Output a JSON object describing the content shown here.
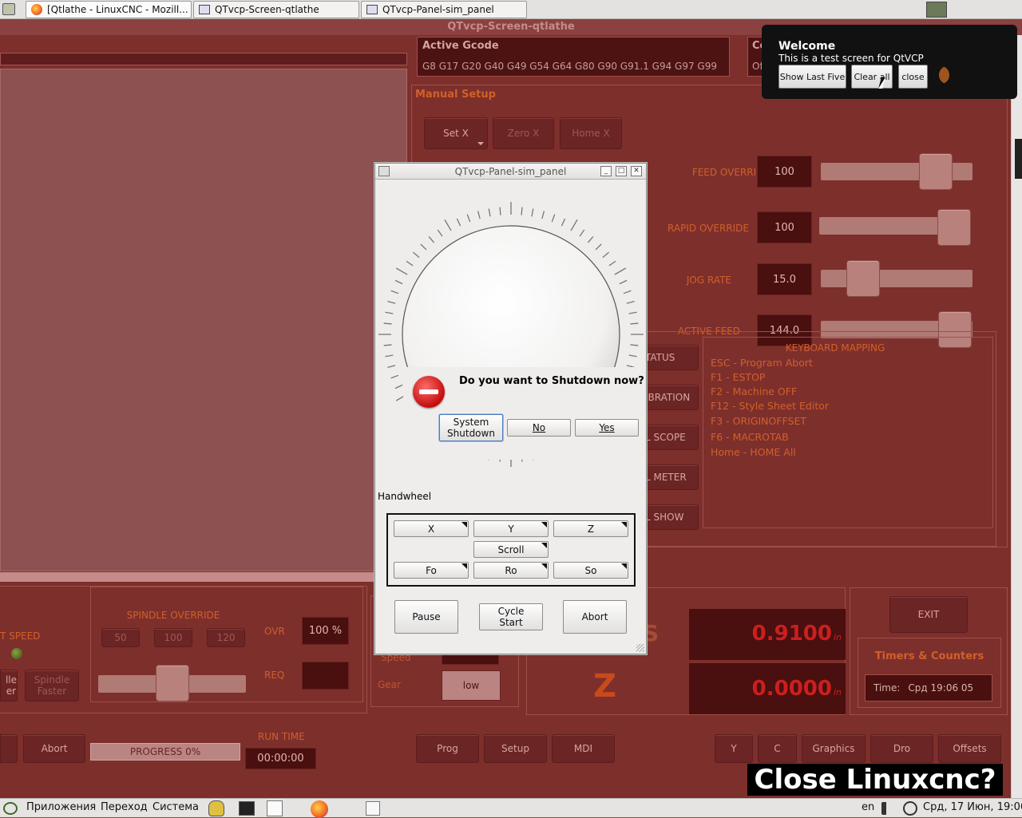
{
  "taskbar_top": {
    "tabs": [
      {
        "label": "[Qtlathe - LinuxCNC - Mozill..."
      },
      {
        "label": "QTvcp-Screen-qtlathe"
      },
      {
        "label": "QTvcp-Panel-sim_panel"
      }
    ]
  },
  "window": {
    "title": "QTvcp-Screen-qtlathe"
  },
  "gcode": {
    "title": "Active Gcode",
    "codes": "G8 G17 G20 G40 G49 G54 G64 G80 G90 G91.1 G94 G97 G99",
    "next_title_fragment": "Co",
    "next_value_fragment": "Of"
  },
  "manual_setup": {
    "title": "Manual Setup",
    "buttons": [
      "Set X",
      "Zero X",
      "Home X"
    ]
  },
  "overrides": [
    {
      "label": "FEED OVERRIDE",
      "value": "100",
      "level": 0.75
    },
    {
      "label": "RAPID OVERRIDE",
      "value": "100",
      "level": 1.0
    },
    {
      "label": "JOG RATE",
      "value": "15.0",
      "level": 0.2
    },
    {
      "label": "ACTIVE FEED",
      "value": "144.0",
      "level": 1.0
    }
  ],
  "side_buttons": [
    "TATUS",
    "IBRATION",
    "L SCOPE",
    "L METER",
    "L SHOW"
  ],
  "keyboard_mapping": {
    "title": "KEYBOARD MAPPING",
    "items": [
      "ESC - Program Abort",
      "F1 - ESTOP",
      "F2 - Machine OFF",
      "F12 - Style Sheet Editor",
      "F3 - ORIGINOFFSET",
      "F6 - MACROTAB",
      "Home - HOME All"
    ]
  },
  "spindle": {
    "title": "SPINDLE OVERRIDE",
    "presets": [
      "50",
      "100",
      "120"
    ],
    "ovr_label": "OVR",
    "ovr_value": "100 %",
    "req_label": "REQ",
    "speed_label_fragment": "T SPEED",
    "slower_fragment": "lle\ner",
    "faster_label": "Spindle\nFaster",
    "level": 0.5
  },
  "gear": {
    "speed_label": "Speed",
    "gear_label": "Gear",
    "gear_value": "low"
  },
  "dro": {
    "axis_big": "Z",
    "s_fragment": "S",
    "x_value": "0.9100",
    "z_value": "0.0000",
    "unit": "in"
  },
  "exit_label": "EXIT",
  "timers": {
    "title": "Timers & Counters",
    "time_label": "Time:",
    "time_value": "Срд 19:06 05"
  },
  "bottom_controls": {
    "abort_label": "Abort",
    "progress_label": "PROGRESS 0%",
    "progress": 0,
    "runtime_label": "RUN TIME",
    "runtime_value": "00:00:00",
    "tabs_mid": [
      "Prog",
      "Setup",
      "MDI"
    ],
    "tabs_right": [
      "Y",
      "C",
      "Graphics",
      "Dro",
      "Offsets"
    ]
  },
  "close_banner": "Close Linuxcnc?",
  "notification": {
    "title": "Welcome",
    "message": "This is a test screen for QtVCP",
    "buttons": [
      "Show Last Five",
      "Clear all",
      "close"
    ]
  },
  "dialog": {
    "title": "QTvcp-Panel-sim_panel",
    "question": "Do you want to Shutdown now?",
    "buttons": {
      "system_shutdown": "System\nShutdown",
      "no": "No",
      "yes": "Yes"
    },
    "handwheel_label": "Handwheel",
    "axis_buttons": [
      "X",
      "Y",
      "Z"
    ],
    "scroll_label": "Scroll",
    "rate_buttons": [
      "Fo",
      "Ro",
      "So"
    ],
    "pause_label": "Pause",
    "cycle_start_label": "Cycle\nStart",
    "abort_label": "Abort"
  },
  "taskbar_bottom": {
    "menus": [
      "Приложения",
      "Переход",
      "Система"
    ],
    "lang": "en",
    "clock": "Срд, 17 Июн, 19:06"
  },
  "colors": {
    "accent": "#d0602a",
    "panel_bg": "#7d2f2c",
    "dro_value": "#cc1f1f"
  }
}
